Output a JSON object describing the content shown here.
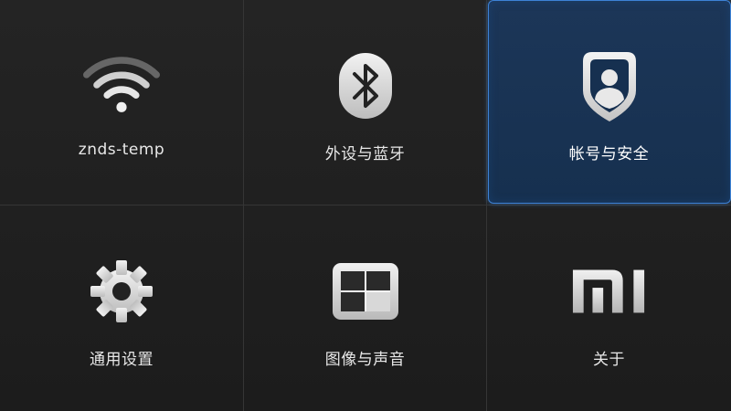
{
  "menu": {
    "items": [
      {
        "label": "znds-temp",
        "icon": "wifi-icon",
        "focused": false
      },
      {
        "label": "外设与蓝牙",
        "icon": "bluetooth-icon",
        "focused": false
      },
      {
        "label": "帐号与安全",
        "icon": "account-shield-icon",
        "focused": true
      },
      {
        "label": "通用设置",
        "icon": "gear-icon",
        "focused": false
      },
      {
        "label": "图像与声音",
        "icon": "picture-grid-icon",
        "focused": false
      },
      {
        "label": "关于",
        "icon": "mi-logo-icon",
        "focused": false
      }
    ]
  },
  "colors": {
    "background": "#1f1f1f",
    "divider": "#353535",
    "focus_border": "#3d82d6",
    "focus_fill": "#16304f",
    "label_text": "#e8e8e8"
  }
}
